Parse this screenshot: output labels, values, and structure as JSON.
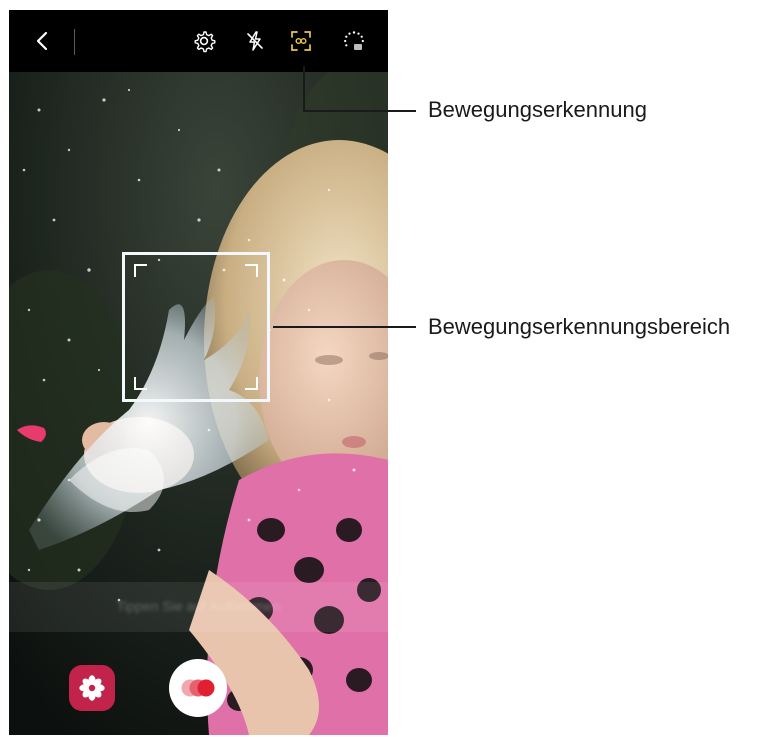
{
  "topbar": {
    "back_icon": "chevron-left-icon",
    "settings_icon": "gear-icon",
    "flash_icon": "flash-off-icon",
    "motion_detection_icon": "motion-detection-icon",
    "timer_icon": "timer-icon"
  },
  "viewfinder": {
    "hint_text": "Tippen Sie auf Aufnehmen"
  },
  "bottom_controls": {
    "effects_icon": "flower-icon",
    "record_icon": "super-slow-mo-record-icon"
  },
  "callouts": {
    "motion_detection": "Bewegungserkennung",
    "motion_detection_area": "Bewegungserkennungsbereich"
  },
  "colors": {
    "accent_yellow": "#e8c84a",
    "effects_red": "#c2234a",
    "record_red": "#e02030"
  }
}
